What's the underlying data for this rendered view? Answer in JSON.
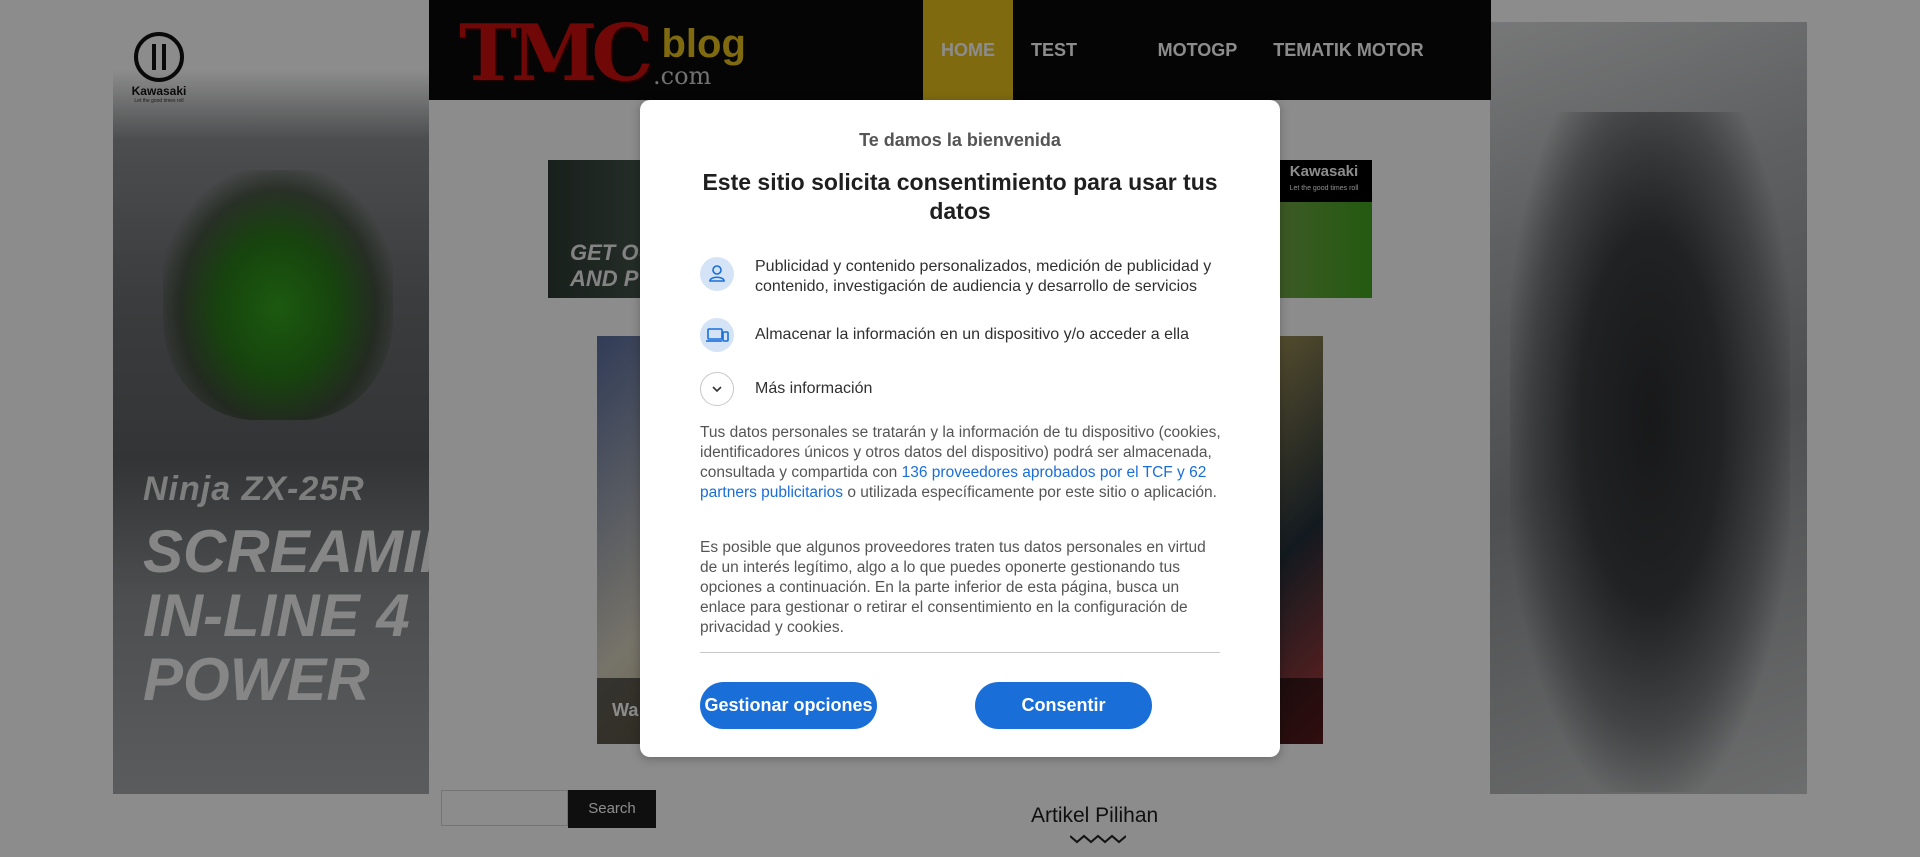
{
  "site": {
    "logo": {
      "main": "TMC",
      "blog": "blog",
      "domain": ".com"
    },
    "nav": [
      {
        "label": "HOME",
        "active": true
      },
      {
        "label": "TEST RIDE",
        "active": false
      },
      {
        "label": "MOTOGP",
        "active": false
      },
      {
        "label": "TEMATIK MOTOR BARU",
        "active": false
      }
    ],
    "left_ad": {
      "brand": "Kawasaki",
      "tagline": "Let the good times roll",
      "model": "Ninja ZX-25R",
      "headline": [
        "SCREAMING",
        "IN-LINE 4",
        "POWER"
      ]
    },
    "top_banner": {
      "text": "GET OUR",
      "subtext": "AND P",
      "brand": "Kawasaki",
      "brand_tag": "Let the good times roll"
    },
    "featured_caption": "Wa",
    "search_button": "Search",
    "artikel_heading": "Artikel Pilihan"
  },
  "consent_dialog": {
    "welcome": "Te damos la bienvenida",
    "title": "Este sitio solicita consentimiento para usar tus datos",
    "purposes": [
      {
        "icon": "person-icon",
        "text": "Publicidad y contenido personalizados, medición de publicidad y contenido, investigación de audiencia y desarrollo de servicios"
      },
      {
        "icon": "devices-icon",
        "text": "Almacenar la información en un dispositivo y/o acceder a ella"
      }
    ],
    "more_info": "Más información",
    "paragraph1": {
      "before": "Tus datos personales se tratarán y la información de tu dispositivo (cookies, identificadores únicos y otros datos del dispositivo) podrá ser almacenada, consultada y compartida con ",
      "link": "136 proveedores aprobados por el TCF y 62 partners publicitarios",
      "after": " o utilizada específicamente por este sitio o aplicación."
    },
    "paragraph2": "Es posible que algunos proveedores traten tus datos personales en virtud de un interés legítimo, algo a lo que puedes oponerte gestionando tus opciones a continuación. En la parte inferior de esta página, busca un enlace para gestionar o retirar el consentimiento en la configuración de privacidad y cookies.",
    "buttons": {
      "manage": "Gestionar opciones",
      "consent": "Consentir"
    }
  },
  "colors": {
    "accent": "#1a6ed8",
    "nav_active": "#e8c21d",
    "header_bg": "#0a0a0a",
    "logo_red": "#cc1010"
  }
}
